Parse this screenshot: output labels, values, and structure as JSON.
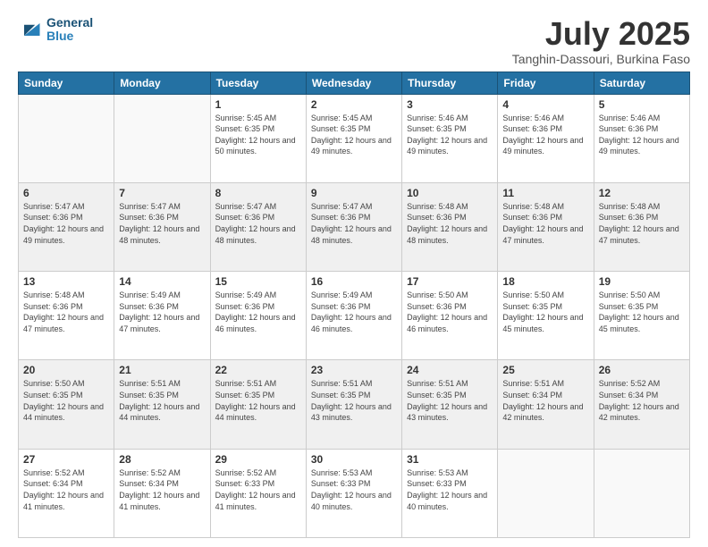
{
  "logo": {
    "line1": "General",
    "line2": "Blue"
  },
  "title": "July 2025",
  "subtitle": "Tanghin-Dassouri, Burkina Faso",
  "weekdays": [
    "Sunday",
    "Monday",
    "Tuesday",
    "Wednesday",
    "Thursday",
    "Friday",
    "Saturday"
  ],
  "weeks": [
    [
      {
        "day": "",
        "info": ""
      },
      {
        "day": "",
        "info": ""
      },
      {
        "day": "1",
        "info": "Sunrise: 5:45 AM\nSunset: 6:35 PM\nDaylight: 12 hours and 50 minutes."
      },
      {
        "day": "2",
        "info": "Sunrise: 5:45 AM\nSunset: 6:35 PM\nDaylight: 12 hours and 49 minutes."
      },
      {
        "day": "3",
        "info": "Sunrise: 5:46 AM\nSunset: 6:35 PM\nDaylight: 12 hours and 49 minutes."
      },
      {
        "day": "4",
        "info": "Sunrise: 5:46 AM\nSunset: 6:36 PM\nDaylight: 12 hours and 49 minutes."
      },
      {
        "day": "5",
        "info": "Sunrise: 5:46 AM\nSunset: 6:36 PM\nDaylight: 12 hours and 49 minutes."
      }
    ],
    [
      {
        "day": "6",
        "info": "Sunrise: 5:47 AM\nSunset: 6:36 PM\nDaylight: 12 hours and 49 minutes."
      },
      {
        "day": "7",
        "info": "Sunrise: 5:47 AM\nSunset: 6:36 PM\nDaylight: 12 hours and 48 minutes."
      },
      {
        "day": "8",
        "info": "Sunrise: 5:47 AM\nSunset: 6:36 PM\nDaylight: 12 hours and 48 minutes."
      },
      {
        "day": "9",
        "info": "Sunrise: 5:47 AM\nSunset: 6:36 PM\nDaylight: 12 hours and 48 minutes."
      },
      {
        "day": "10",
        "info": "Sunrise: 5:48 AM\nSunset: 6:36 PM\nDaylight: 12 hours and 48 minutes."
      },
      {
        "day": "11",
        "info": "Sunrise: 5:48 AM\nSunset: 6:36 PM\nDaylight: 12 hours and 47 minutes."
      },
      {
        "day": "12",
        "info": "Sunrise: 5:48 AM\nSunset: 6:36 PM\nDaylight: 12 hours and 47 minutes."
      }
    ],
    [
      {
        "day": "13",
        "info": "Sunrise: 5:48 AM\nSunset: 6:36 PM\nDaylight: 12 hours and 47 minutes."
      },
      {
        "day": "14",
        "info": "Sunrise: 5:49 AM\nSunset: 6:36 PM\nDaylight: 12 hours and 47 minutes."
      },
      {
        "day": "15",
        "info": "Sunrise: 5:49 AM\nSunset: 6:36 PM\nDaylight: 12 hours and 46 minutes."
      },
      {
        "day": "16",
        "info": "Sunrise: 5:49 AM\nSunset: 6:36 PM\nDaylight: 12 hours and 46 minutes."
      },
      {
        "day": "17",
        "info": "Sunrise: 5:50 AM\nSunset: 6:36 PM\nDaylight: 12 hours and 46 minutes."
      },
      {
        "day": "18",
        "info": "Sunrise: 5:50 AM\nSunset: 6:35 PM\nDaylight: 12 hours and 45 minutes."
      },
      {
        "day": "19",
        "info": "Sunrise: 5:50 AM\nSunset: 6:35 PM\nDaylight: 12 hours and 45 minutes."
      }
    ],
    [
      {
        "day": "20",
        "info": "Sunrise: 5:50 AM\nSunset: 6:35 PM\nDaylight: 12 hours and 44 minutes."
      },
      {
        "day": "21",
        "info": "Sunrise: 5:51 AM\nSunset: 6:35 PM\nDaylight: 12 hours and 44 minutes."
      },
      {
        "day": "22",
        "info": "Sunrise: 5:51 AM\nSunset: 6:35 PM\nDaylight: 12 hours and 44 minutes."
      },
      {
        "day": "23",
        "info": "Sunrise: 5:51 AM\nSunset: 6:35 PM\nDaylight: 12 hours and 43 minutes."
      },
      {
        "day": "24",
        "info": "Sunrise: 5:51 AM\nSunset: 6:35 PM\nDaylight: 12 hours and 43 minutes."
      },
      {
        "day": "25",
        "info": "Sunrise: 5:51 AM\nSunset: 6:34 PM\nDaylight: 12 hours and 42 minutes."
      },
      {
        "day": "26",
        "info": "Sunrise: 5:52 AM\nSunset: 6:34 PM\nDaylight: 12 hours and 42 minutes."
      }
    ],
    [
      {
        "day": "27",
        "info": "Sunrise: 5:52 AM\nSunset: 6:34 PM\nDaylight: 12 hours and 41 minutes."
      },
      {
        "day": "28",
        "info": "Sunrise: 5:52 AM\nSunset: 6:34 PM\nDaylight: 12 hours and 41 minutes."
      },
      {
        "day": "29",
        "info": "Sunrise: 5:52 AM\nSunset: 6:33 PM\nDaylight: 12 hours and 41 minutes."
      },
      {
        "day": "30",
        "info": "Sunrise: 5:53 AM\nSunset: 6:33 PM\nDaylight: 12 hours and 40 minutes."
      },
      {
        "day": "31",
        "info": "Sunrise: 5:53 AM\nSunset: 6:33 PM\nDaylight: 12 hours and 40 minutes."
      },
      {
        "day": "",
        "info": ""
      },
      {
        "day": "",
        "info": ""
      }
    ]
  ],
  "colors": {
    "header_bg": "#2471a3",
    "row_shade": "#f0f0f0",
    "row_white": "#ffffff"
  }
}
